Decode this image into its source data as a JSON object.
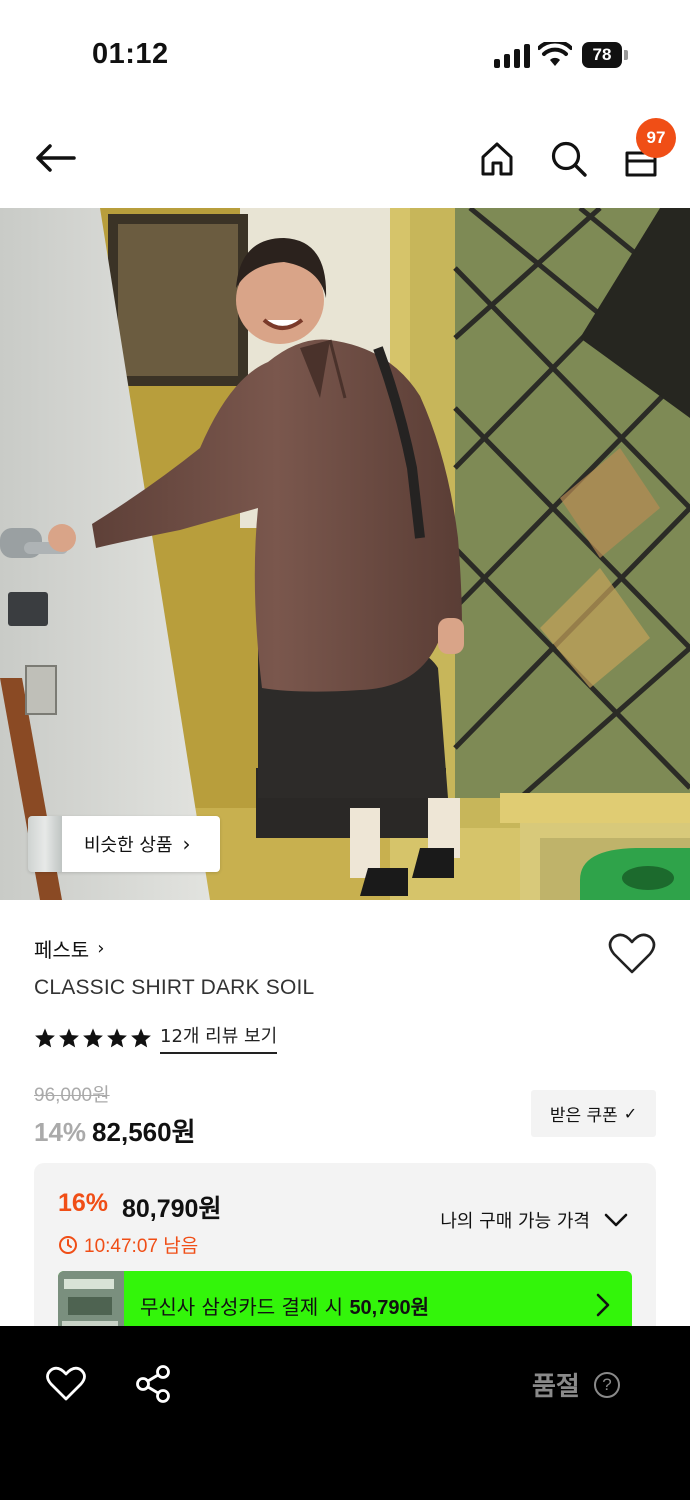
{
  "status_bar": {
    "time": "01:12",
    "battery": "78",
    "icons": [
      "signal-icon",
      "wifi-icon",
      "battery-icon"
    ]
  },
  "nav": {
    "icons": [
      "back-arrow-icon",
      "home-icon",
      "search-icon",
      "shopping-bag-icon"
    ],
    "cart_count": "97"
  },
  "hero": {
    "similar_button_label": "비슷한 상품"
  },
  "product": {
    "brand": "페스토",
    "title": "CLASSIC SHIRT DARK SOIL",
    "rating_stars": 5,
    "review_link": "12개 리뷰 보기",
    "original_price": "96,000원",
    "discount_rate": "14%",
    "sale_price": "82,560원",
    "coupon_button": "받은 쿠폰"
  },
  "best_price": {
    "discount_rate": "16%",
    "price": "80,790원",
    "timer": "10:47:07 남음",
    "my_price_label": "나의 구매 가능 가격",
    "card_banner_text_prefix": "무신사 삼성카드 결제 시 ",
    "card_banner_price": "50,790원"
  },
  "bottom_bar": {
    "soldout_label": "품절",
    "help_icon": "?"
  },
  "colors": {
    "accent_orange": "#f04e16",
    "banner_green": "#33f50a",
    "bottom_bar": "#000000",
    "muted_text": "#aaaaaa"
  }
}
